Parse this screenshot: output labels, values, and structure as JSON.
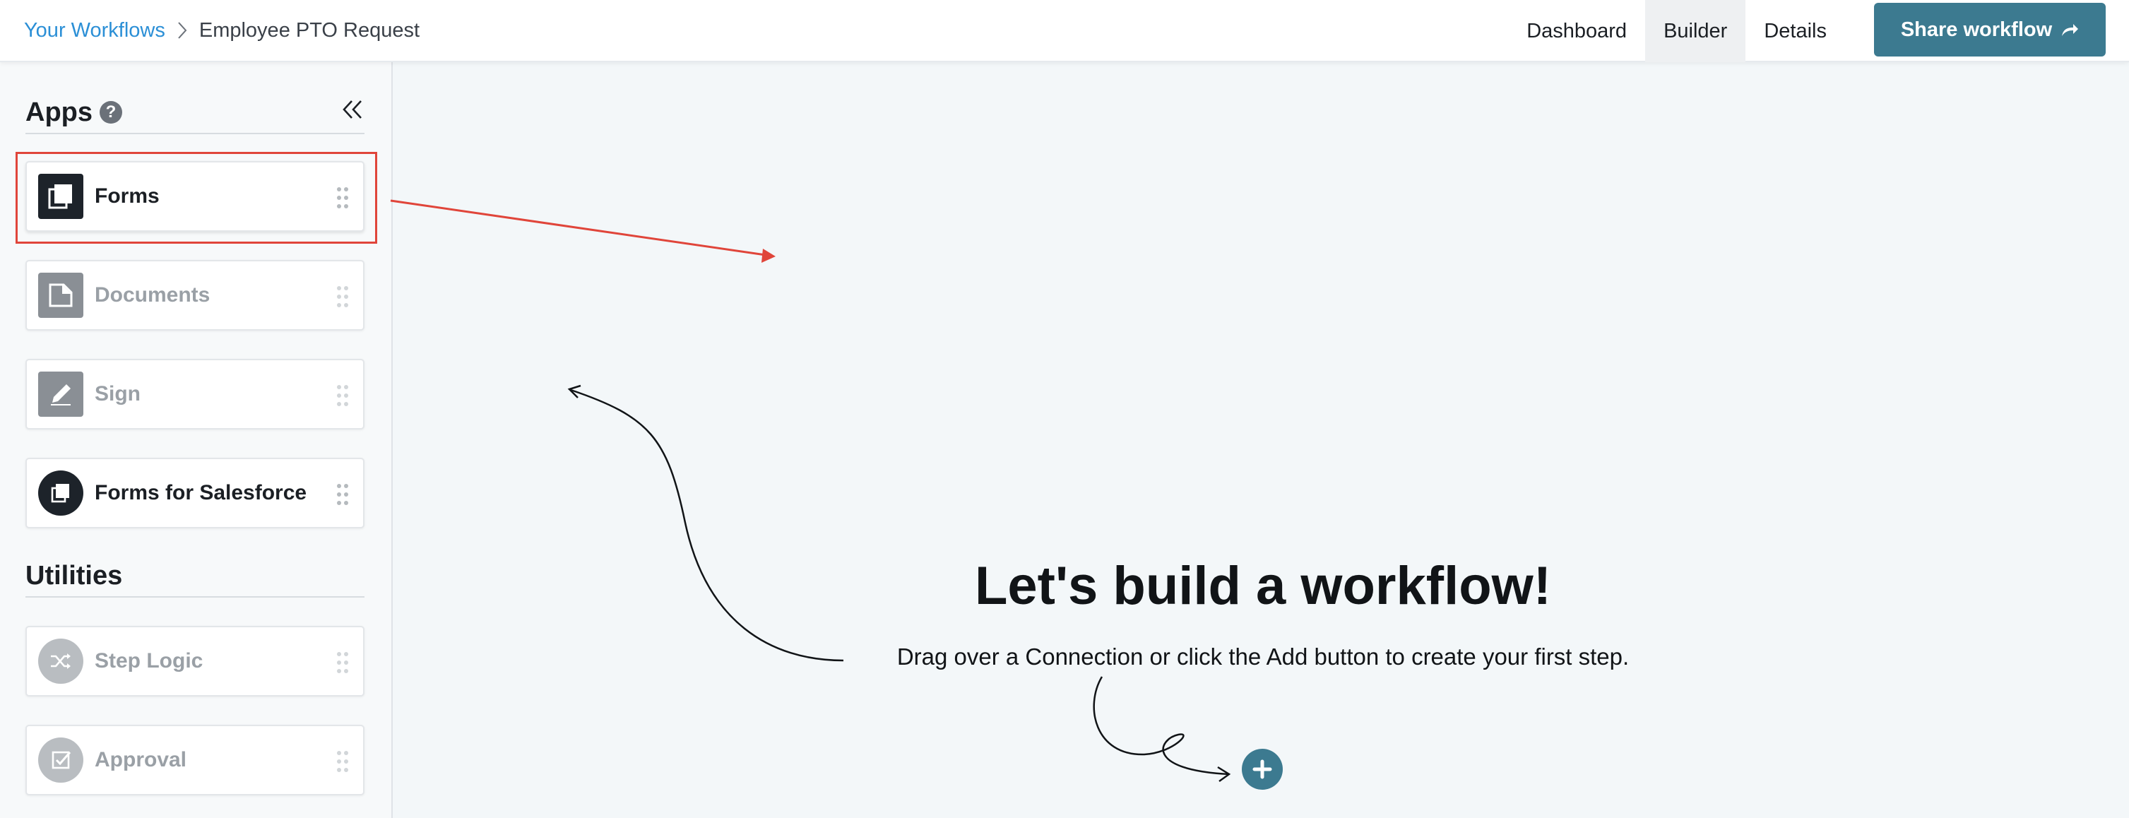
{
  "header": {
    "breadcrumb": {
      "parent": "Your Workflows",
      "current": "Employee PTO Request"
    },
    "nav": [
      {
        "label": "Dashboard",
        "active": false
      },
      {
        "label": "Builder",
        "active": true
      },
      {
        "label": "Details",
        "active": false
      }
    ],
    "share_button": "Share workflow"
  },
  "sidebar": {
    "apps_title": "Apps",
    "apps": [
      {
        "label": "Forms",
        "icon": "forms-icon",
        "enabled": true,
        "highlighted": true
      },
      {
        "label": "Documents",
        "icon": "documents-icon",
        "enabled": false
      },
      {
        "label": "Sign",
        "icon": "pencil-icon",
        "enabled": false
      },
      {
        "label": "Forms for Salesforce",
        "icon": "salesforce-forms-icon",
        "enabled": true
      }
    ],
    "utilities_title": "Utilities",
    "utilities": [
      {
        "label": "Step Logic",
        "icon": "shuffle-icon",
        "enabled": false
      },
      {
        "label": "Approval",
        "icon": "approval-check-icon",
        "enabled": false
      }
    ]
  },
  "canvas": {
    "title": "Let's build a workflow!",
    "subtitle": "Drag over a Connection or click the Add button to create your first step."
  },
  "colors": {
    "accent": "#3c7a90",
    "link": "#2b8fd6",
    "highlight": "#e0453a",
    "canvas_bg": "#f3f7f9"
  }
}
